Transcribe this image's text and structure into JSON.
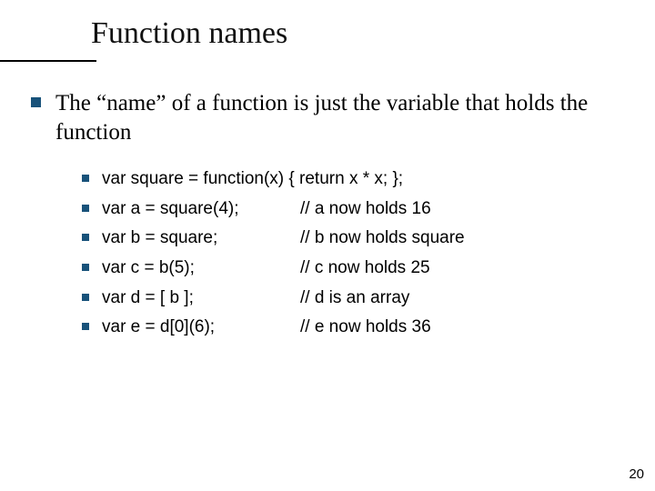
{
  "slide": {
    "title": "Function names",
    "main_text": "The “name” of a function is just the variable that holds the function",
    "code_lines": [
      {
        "full": "var square = function(x) { return x * x; };"
      },
      {
        "code": "var a = square(4);",
        "comment": "// a now holds 16"
      },
      {
        "code": "var b = square;",
        "comment": "// b now holds square"
      },
      {
        "code": "var c = b(5);",
        "comment": "// c now holds 25"
      },
      {
        "code": "var d = [ b ];",
        "comment": "// d is an array"
      },
      {
        "code": "var e = d[0](6);",
        "comment": "// e now holds 36"
      }
    ],
    "page_number": "20"
  }
}
